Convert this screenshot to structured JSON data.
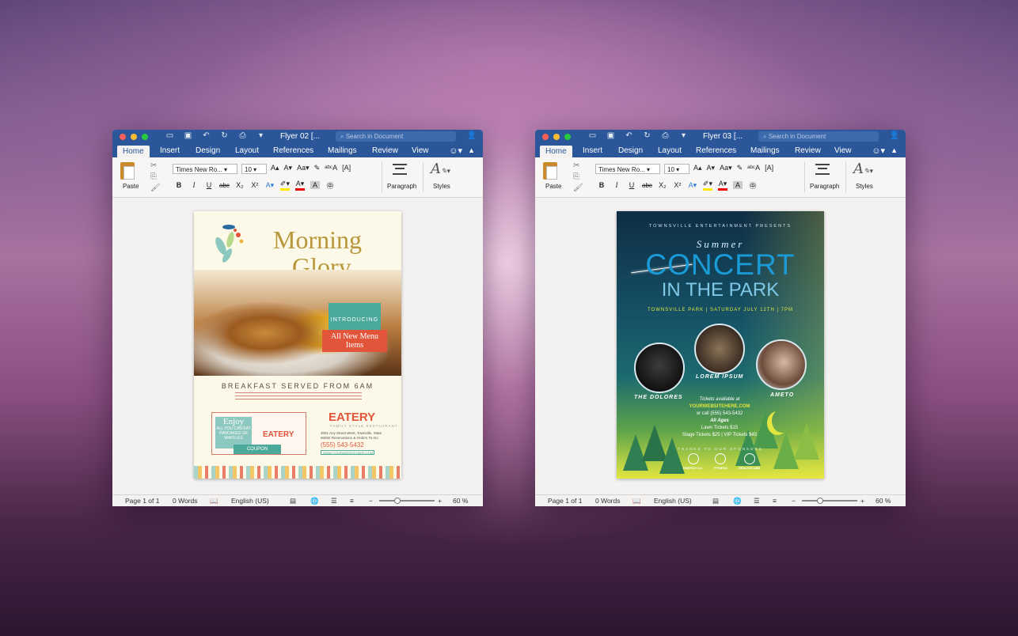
{
  "windows": [
    {
      "title": "Flyer 02 [...",
      "search_placeholder": "Search in Document",
      "tabs": [
        "Home",
        "Insert",
        "Design",
        "Layout",
        "References",
        "Mailings",
        "Review",
        "View"
      ],
      "font_name": "Times New Ro...",
      "font_size": "10",
      "paste_label": "Paste",
      "paragraph_label": "Paragraph",
      "styles_label": "Styles",
      "status": {
        "page": "Page 1 of 1",
        "words": "0 Words",
        "language": "English (US)",
        "zoom": "60 %"
      }
    },
    {
      "title": "Flyer 03 [...",
      "search_placeholder": "Search in Document",
      "tabs": [
        "Home",
        "Insert",
        "Design",
        "Layout",
        "References",
        "Mailings",
        "Review",
        "View"
      ],
      "font_name": "Times New Ro...",
      "font_size": "10",
      "paste_label": "Paste",
      "paragraph_label": "Paragraph",
      "styles_label": "Styles",
      "status": {
        "page": "Page 1 of 1",
        "words": "0 Words",
        "language": "English (US)",
        "zoom": "60 %"
      }
    }
  ],
  "ribbon_buttons": {
    "bold": "B",
    "italic": "I",
    "underline": "U",
    "strike": "abc",
    "sub": "X₂",
    "sup": "X²"
  },
  "flyer1": {
    "title_line1": "Morning",
    "title_line2": "Glory",
    "introducing": "INTRODUCING",
    "new_items": "All New Menu Items",
    "breakfast": "BREAKFAST SERVED FROM 6AM",
    "enjoy": "Enjoy",
    "enjoy_sub": "ALL YOU CAN EAT PANCAKES OR WAFFLES",
    "coupon": "COUPON",
    "eatery": "EATERY",
    "tagline": "FAMILY STYLE RESTAURANT",
    "address": "3051 Any Street West, Townville, State 00000 Reservations & Orders To-Go",
    "phone": "(555) 543-5432",
    "website": "WWW.YOURWEBSITEHERE.COM"
  },
  "flyer2": {
    "presents": "TOWNSVILLE ENTERTAINMENT PRESENTS",
    "summer": "Summer",
    "concert": "CONCERT",
    "park": "IN THE PARK",
    "date_line": "TOWNSVILLE PARK | SATURDAY JULY 12TH | 7PM",
    "band1": "THE DOLORES",
    "band2": "LOREM IPSUM",
    "band3": "AMETO",
    "tickets": "Tickets available at",
    "website": "YOURWEBSITEHERE.COM",
    "call": "or call (555) 543-5432",
    "ages": "All Ages",
    "lawn": "Lawn Tickets $15",
    "stage": "Stage Tickets $25 | VIP Tickets $45",
    "thanks": "THANKS TO OUR SPONSORS",
    "sponsor1": "ENERGY CO.",
    "sponsor2": "FITNESS",
    "sponsor3": "HEALTHCARE"
  }
}
